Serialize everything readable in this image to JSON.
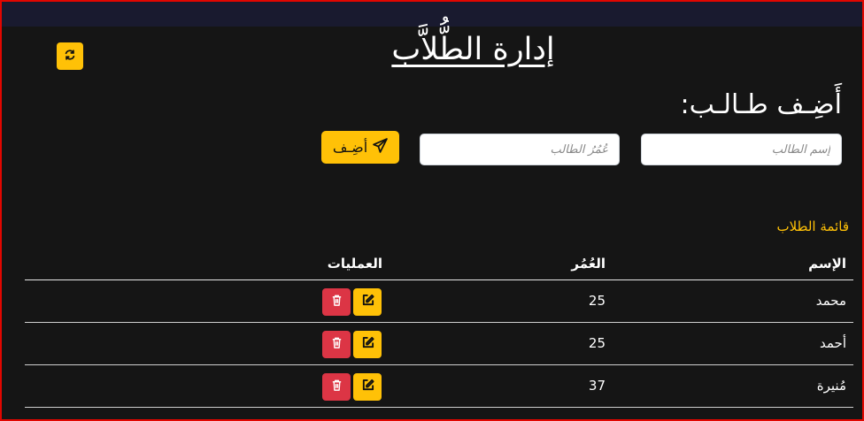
{
  "page": {
    "title": "إدارة الطُّلاَّب",
    "add_heading": "أَضِـف طـالـب:"
  },
  "form": {
    "name_placeholder": "إسم الطّالب",
    "age_placeholder": "عُمُرُ الطّالب",
    "add_button_label": "أضِـف"
  },
  "list": {
    "title": "قائمة الطلاب",
    "columns": {
      "name": "الإسم",
      "age": "العُمُر",
      "operations": "العمليات"
    },
    "rows": [
      {
        "name": "محمد",
        "age": "25"
      },
      {
        "name": "أحمد",
        "age": "25"
      },
      {
        "name": "مُنيرة",
        "age": "37"
      }
    ]
  },
  "icons": {
    "refresh": "refresh-icon",
    "send": "paper-plane-icon",
    "edit": "edit-icon",
    "delete": "trash-icon"
  },
  "colors": {
    "accent": "#ffc107",
    "danger": "#dc3545",
    "background": "#151515",
    "topbar": "#191a2f",
    "frame": "#e10600"
  }
}
